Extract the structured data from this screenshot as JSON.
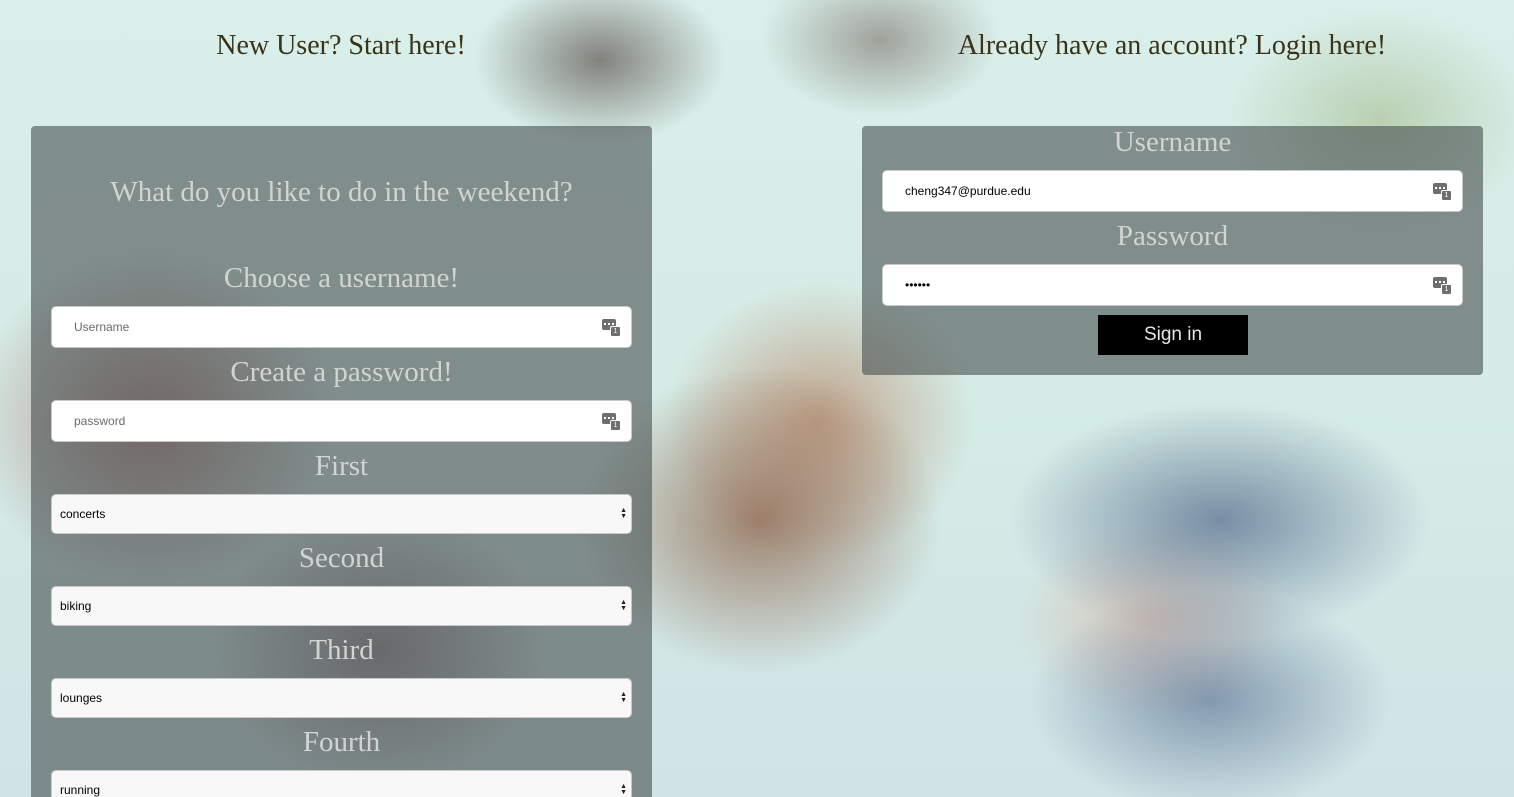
{
  "signup": {
    "heading": "New User? Start here!",
    "question": "What do you like to do in the weekend?",
    "username_label": "Choose a username!",
    "username_placeholder": "Username",
    "password_label": "Create a password!",
    "password_placeholder": "password",
    "choices": [
      {
        "label": "First",
        "value": "concerts"
      },
      {
        "label": "Second",
        "value": "biking"
      },
      {
        "label": "Third",
        "value": "lounges"
      },
      {
        "label": "Fourth",
        "value": "running"
      }
    ]
  },
  "login": {
    "heading": "Already have an account? Login here!",
    "username_label": "Username",
    "username_value": "cheng347@purdue.edu",
    "password_label": "Password",
    "password_value": "••••••",
    "signin_label": "Sign in"
  },
  "icons": {
    "credential_autofill": "key-autofill-icon",
    "select_arrows": "select-arrows-icon"
  },
  "colors": {
    "heading_text": "#3a3318",
    "panel_label_text": "#d2d4d2",
    "panel_background": "rgba(75,82,82,0.62)",
    "signin_button_bg": "#000000"
  }
}
